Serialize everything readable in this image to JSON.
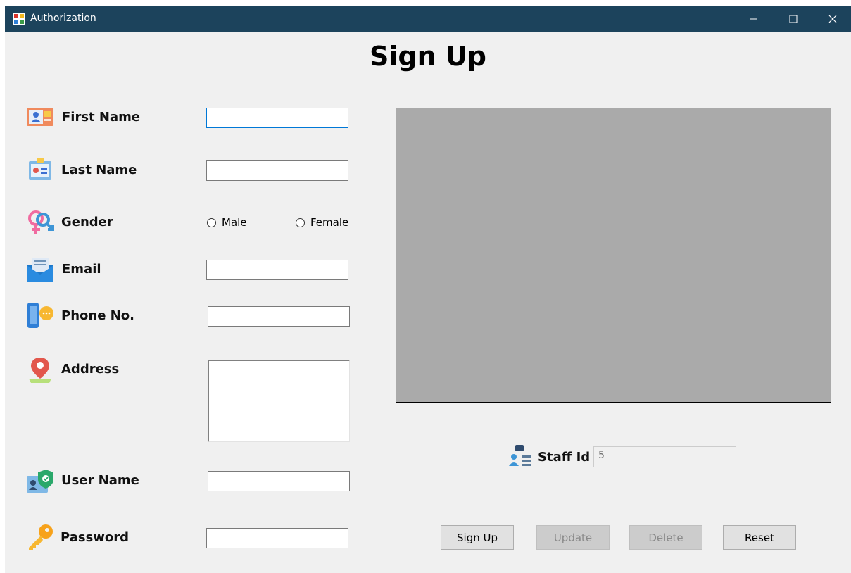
{
  "window": {
    "title": "Authorization",
    "app_icon": "form-app-icon"
  },
  "titlebar_controls": [
    "minimize-icon",
    "maximize-icon",
    "close-icon"
  ],
  "heading": "Sign Up",
  "fields": {
    "first_name": {
      "label": "First Name",
      "value": "",
      "icon": "contact-card-icon"
    },
    "last_name": {
      "label": "Last Name",
      "value": "",
      "icon": "id-badge-icon"
    },
    "gender": {
      "label": "Gender",
      "icon": "gender-symbols-icon",
      "options": [
        "Male",
        "Female"
      ],
      "selected": null
    },
    "email": {
      "label": "Email",
      "value": "",
      "icon": "envelope-icon"
    },
    "phone": {
      "label": "Phone No.",
      "value": "",
      "icon": "phone-chat-icon"
    },
    "address": {
      "label": "Address",
      "value": "",
      "icon": "location-pin-icon"
    },
    "user_name": {
      "label": "User Name",
      "value": "",
      "icon": "user-shield-icon"
    },
    "password": {
      "label": "Password",
      "value": "",
      "icon": "key-icon"
    }
  },
  "staff": {
    "label": "Staff Id",
    "value": "5",
    "icon": "staff-list-icon"
  },
  "buttons": {
    "sign_up": "Sign Up",
    "update": "Update",
    "delete": "Delete",
    "reset": "Reset"
  },
  "colors": {
    "titlebar": "#1c435c",
    "photo_placeholder": "#aaaaaa",
    "window_bg": "#f0f0f0",
    "focus_border": "#0078d7"
  }
}
